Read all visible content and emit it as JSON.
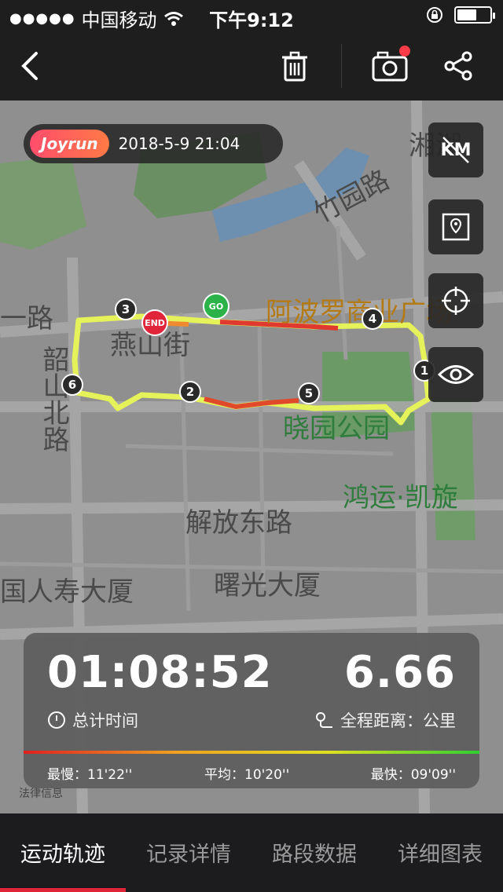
{
  "status_bar": {
    "carrier": "中国移动",
    "time": "下午9:12",
    "battery_level": 0.6
  },
  "nav": {
    "icons": [
      "back-icon",
      "trash-icon",
      "camera-icon",
      "share-icon"
    ]
  },
  "brand": {
    "name": "Joyrun",
    "date": "2018-5-9 21:04"
  },
  "map_controls": {
    "unit_label": "KM"
  },
  "map_labels": {
    "l1": "湘湖",
    "l2": "竹园路",
    "l3": "阿波罗商业广场",
    "l4": "一路",
    "l5": "燕山街",
    "l6": "韶山北路",
    "l7": "晓园公园",
    "l8": "鸿运·凯旋",
    "l9": "解放东路",
    "l10": "曙光大厦",
    "l11": "国人寿大厦",
    "l12": "法律信息"
  },
  "route": {
    "start_label": "GO",
    "end_label": "END",
    "markers": [
      "1",
      "2",
      "3",
      "4",
      "5",
      "6"
    ]
  },
  "stats": {
    "duration": "01:08:52",
    "duration_caption": "总计时间",
    "distance": "6.66",
    "distance_caption": "全程距离：公里",
    "slowest": "最慢：11'22''",
    "average": "平均：10'20''",
    "fastest": "最快：09'09''"
  },
  "tabs": [
    {
      "label": "运动轨迹",
      "active": true
    },
    {
      "label": "记录详情",
      "active": false
    },
    {
      "label": "路段数据",
      "active": false
    },
    {
      "label": "详细图表",
      "active": false
    }
  ],
  "colors": {
    "accent": "#e0243a",
    "route": "#e6f25a",
    "brand": "#ff5a5f"
  }
}
